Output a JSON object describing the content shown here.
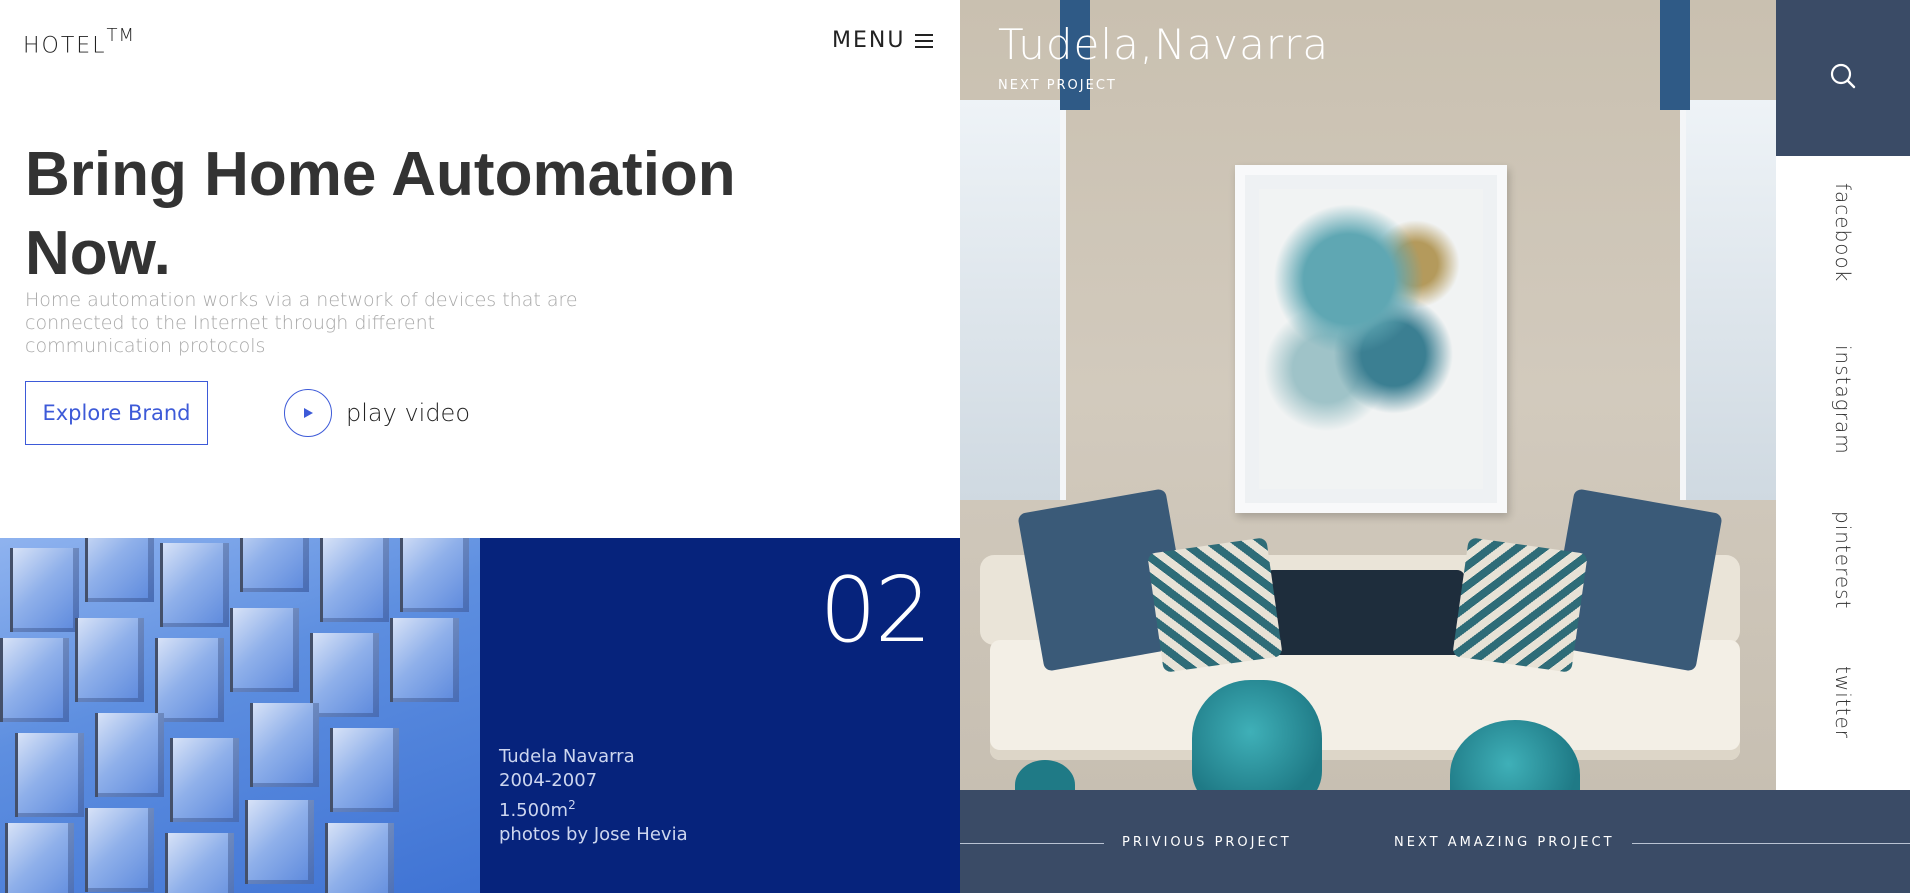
{
  "header": {
    "logo": "HOTEL",
    "logo_mark": "TM",
    "menu_label": "MENU",
    "menu_icon": "hamburger-icon"
  },
  "hero": {
    "title_line1": "Bring Home Automation",
    "title_line2": "Now.",
    "description": "Home automation works via a network of devices that are connected to the Internet through different communication protocols",
    "explore_label": "Explore Brand",
    "play_label": "play video",
    "play_icon": "play-icon"
  },
  "project_card": {
    "number": "02",
    "name": "Tudela Navarra",
    "years": "2004-2007",
    "area": "1.500m",
    "area_unit_sup": "2",
    "credit": "photos by Jose Hevia"
  },
  "feature": {
    "title": "Tudela,Navarra",
    "subtitle": "NEXT PROJECT"
  },
  "sidebar": {
    "search_icon": "search-icon",
    "social": [
      "facebook",
      "instagram",
      "pinterest",
      "twitter"
    ]
  },
  "footer_nav": {
    "prev_label": "PRIVIOUS PROJECT",
    "next_label": "NEXT AMAZING PROJECT"
  },
  "colors": {
    "accent_blue": "#3d5ad8",
    "navy_block": "#06237c",
    "slate": "#3a4b66",
    "heading": "#333333"
  }
}
